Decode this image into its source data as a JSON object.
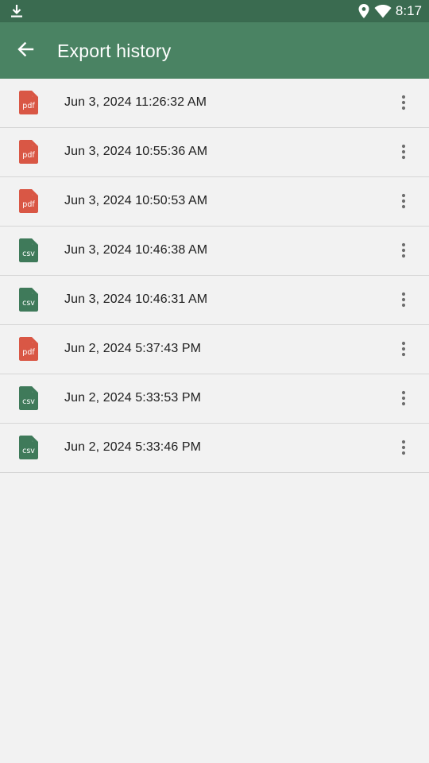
{
  "status_bar": {
    "time": "8:17",
    "icons": [
      "download-icon",
      "location-icon",
      "wifi-icon"
    ]
  },
  "app_bar": {
    "title": "Export history",
    "back_icon": "arrow-back-icon"
  },
  "colors": {
    "status_bar": "#3a6b50",
    "app_bar": "#4a8363",
    "pdf": "#d95745",
    "csv": "#3f7a5a",
    "background": "#f2f2f2"
  },
  "exports": [
    {
      "type": "pdf",
      "label": "pdf",
      "timestamp": "Jun 3, 2024 11:26:32 AM"
    },
    {
      "type": "pdf",
      "label": "pdf",
      "timestamp": "Jun 3, 2024 10:55:36 AM"
    },
    {
      "type": "pdf",
      "label": "pdf",
      "timestamp": "Jun 3, 2024 10:50:53 AM"
    },
    {
      "type": "csv",
      "label": "csv",
      "timestamp": "Jun 3, 2024 10:46:38 AM"
    },
    {
      "type": "csv",
      "label": "csv",
      "timestamp": "Jun 3, 2024 10:46:31 AM"
    },
    {
      "type": "pdf",
      "label": "pdf",
      "timestamp": "Jun 2, 2024 5:37:43 PM"
    },
    {
      "type": "csv",
      "label": "csv",
      "timestamp": "Jun 2, 2024 5:33:53 PM"
    },
    {
      "type": "csv",
      "label": "csv",
      "timestamp": "Jun 2, 2024 5:33:46 PM"
    }
  ]
}
